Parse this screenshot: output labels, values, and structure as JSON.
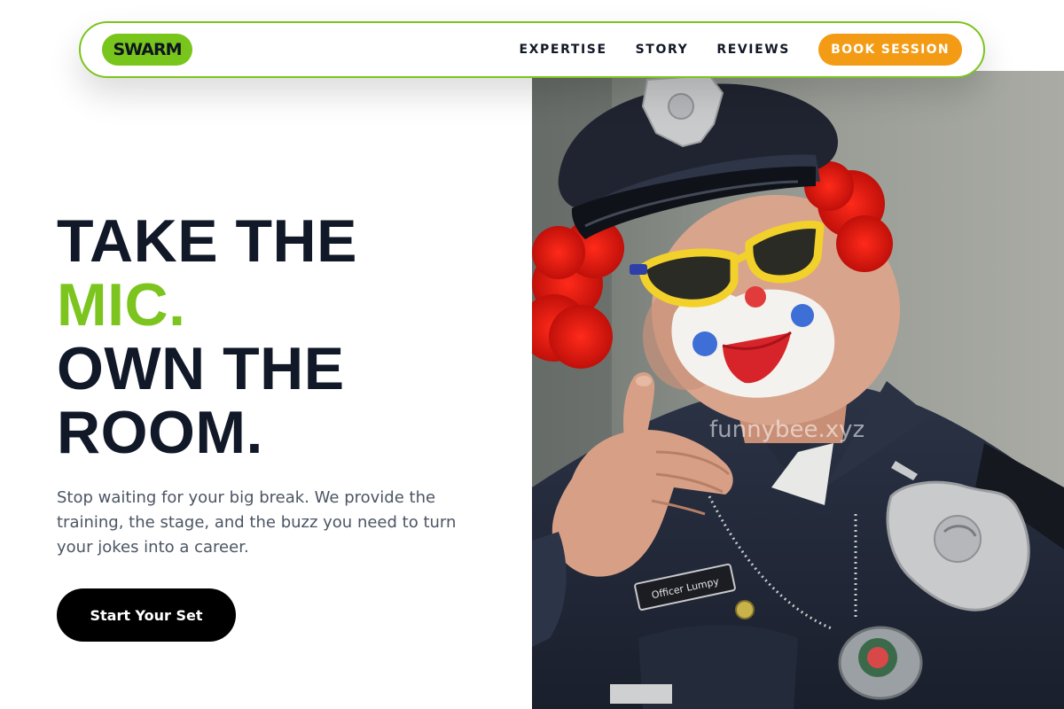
{
  "nav": {
    "logo": "SWARM",
    "links": [
      "EXPERTISE",
      "STORY",
      "REVIEWS"
    ],
    "cta": "BOOK SESSION"
  },
  "hero": {
    "headline": [
      "TAKE THE",
      "MIC.",
      "OWN THE",
      "ROOM."
    ],
    "subtitle": "Stop waiting for your big break. We provide the training, the stage, and the buzz you need to turn your jokes into a career.",
    "cta": "Start Your Set"
  },
  "image": {
    "watermark": "funnybee.xyz",
    "name_tag": "Officer Lumpy"
  },
  "colors": {
    "accent_green": "#7cc41e",
    "accent_orange": "#f39b14",
    "text_dark": "#111827",
    "text_muted": "#4b5563"
  }
}
